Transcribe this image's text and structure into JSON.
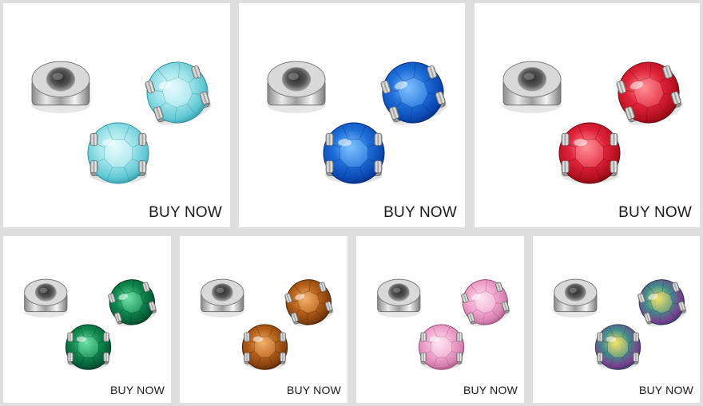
{
  "buy_label": "BUY NOW",
  "products": [
    {
      "crystal_color": "light-aqua",
      "base": "#9fe3ea",
      "mid": "#5fc7d3",
      "dark": "#2a8f9e",
      "light": "#e4fbfd"
    },
    {
      "crystal_color": "sapphire-blue",
      "base": "#1f6fd9",
      "mid": "#0b49b3",
      "dark": "#062a78",
      "light": "#7ec0ff"
    },
    {
      "crystal_color": "ruby-red",
      "base": "#e0243a",
      "mid": "#b3101f",
      "dark": "#6e0710",
      "light": "#ff8f96"
    },
    {
      "crystal_color": "emerald-green",
      "base": "#128a50",
      "mid": "#07603a",
      "dark": "#033a22",
      "light": "#6fe0a8"
    },
    {
      "crystal_color": "smoked-topaz",
      "base": "#b8621b",
      "mid": "#87420e",
      "dark": "#4f2406",
      "light": "#f2b06a"
    },
    {
      "crystal_color": "light-rose",
      "base": "#f2a9cf",
      "mid": "#d681b0",
      "dark": "#9c4f7c",
      "light": "#fde3f1"
    },
    {
      "crystal_color": "vitrail-rainbow",
      "base": "#3f8e8a",
      "mid": "#7a3f8f",
      "dark": "#2c3a5c",
      "light": "#f5e36a"
    }
  ]
}
